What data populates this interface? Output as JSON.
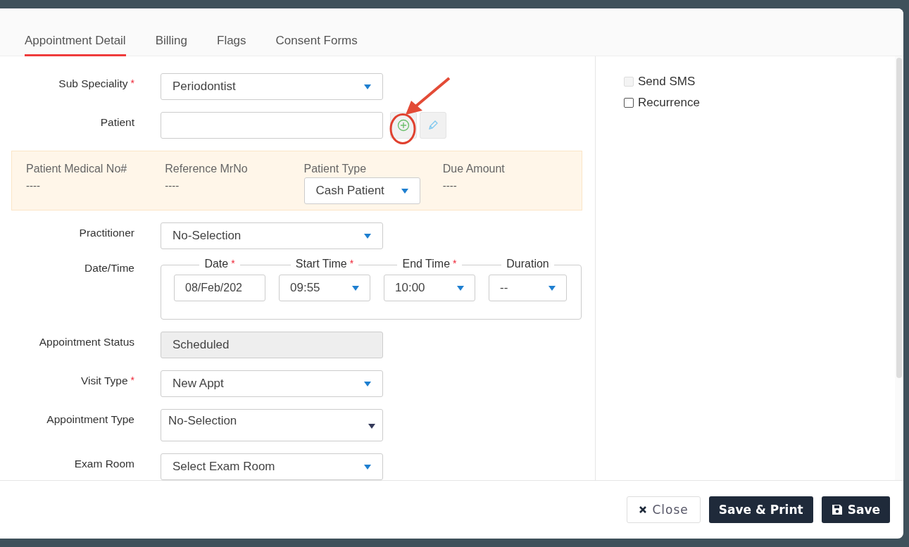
{
  "tabs": [
    {
      "label": "Appointment Detail",
      "selected": true
    },
    {
      "label": "Billing",
      "selected": false
    },
    {
      "label": "Flags",
      "selected": false
    },
    {
      "label": "Consent Forms",
      "selected": false
    }
  ],
  "fields_top": [
    {
      "kind": "select",
      "label": "Sub Speciality",
      "required_mark": "*",
      "value": "Periodontist"
    },
    {
      "kind": "patient",
      "label": "Patient"
    }
  ],
  "patient_info": [
    {
      "kind": "text",
      "label": "Patient Medical No#",
      "value": "----"
    },
    {
      "kind": "text",
      "label": "Reference MrNo",
      "value": "----"
    },
    {
      "kind": "select",
      "label": "Patient Type",
      "value": "Cash Patient"
    },
    {
      "kind": "text",
      "label": "Due Amount",
      "value": "----"
    }
  ],
  "fields_bottom": [
    {
      "kind": "select",
      "label": "Practitioner",
      "value": "No-Selection"
    },
    {
      "kind": "datetime",
      "label": "Date/Time",
      "parts": [
        {
          "kind": "input",
          "label": "Date",
          "required_mark": "*",
          "value": "08/Feb/202"
        },
        {
          "kind": "select",
          "label": "Start Time",
          "required_mark": "*",
          "value": "09:55"
        },
        {
          "kind": "select",
          "label": "End Time",
          "required_mark": "*",
          "value": "10:00"
        },
        {
          "kind": "select",
          "label": "Duration",
          "value": "--"
        }
      ]
    },
    {
      "kind": "readonly",
      "label": "Appointment Status",
      "value": "Scheduled"
    },
    {
      "kind": "select",
      "label": "Visit Type",
      "required_mark": "*",
      "value": "New Appt"
    },
    {
      "kind": "tall-select",
      "label": "Appointment Type",
      "value": "No-Selection"
    },
    {
      "kind": "select",
      "label": "Exam Room",
      "value": "Select Exam Room"
    }
  ],
  "options": [
    {
      "label": "Send SMS",
      "checked": false,
      "disabled": true
    },
    {
      "label": "Recurrence",
      "checked": false,
      "disabled": false
    }
  ],
  "buttons": [
    {
      "kind": "close",
      "label": "Close"
    },
    {
      "kind": "primary",
      "label": "Save & Print"
    },
    {
      "kind": "save",
      "label": "Save"
    }
  ]
}
